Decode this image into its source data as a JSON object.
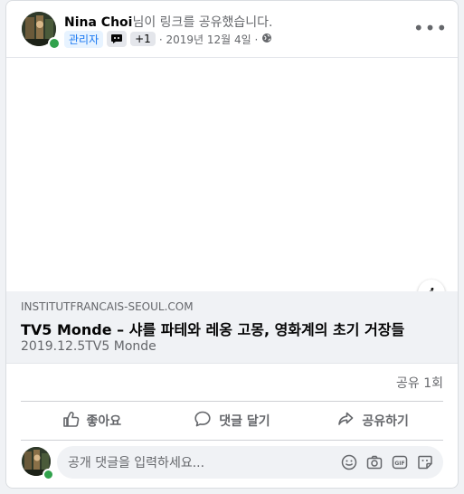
{
  "post": {
    "author": "Nina Choi",
    "action_text": "님이 링크를 공유했습니다.",
    "admin_badge": "관리자",
    "extra_badge_count": "+1",
    "timestamp": "· 2019년 12월 4일 ·",
    "privacy_icon": "globe-icon",
    "more_label": "•••"
  },
  "link": {
    "domain": "INSTITUTFRANCAIS-SEOUL.COM",
    "title": "TV5 Monde – 샤를 파테와 레옹 고몽, 영화계의 초기 거장들",
    "subtitle": "2019.12.5TV5 Monde",
    "info_label": "i"
  },
  "stats": {
    "shares": "공유 1회"
  },
  "actions": {
    "like": "좋아요",
    "comment": "댓글 달기",
    "share": "공유하기"
  },
  "comment_input": {
    "placeholder": "공개 댓글을 입력하세요..."
  },
  "colors": {
    "accent": "#1877f2",
    "online": "#31a24c",
    "secondary_text": "#65676b"
  }
}
